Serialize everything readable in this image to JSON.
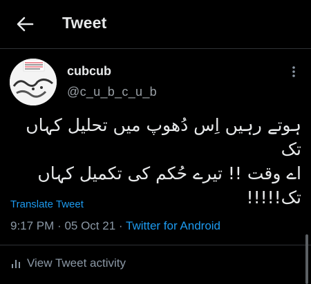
{
  "header": {
    "title": "Tweet",
    "back_icon": "arrow-left-icon"
  },
  "tweet": {
    "display_name": "cubcub",
    "handle": "@c_u_b_c_u_b",
    "more_icon": "vertical-ellipsis-icon",
    "text_lines": [
      "ہوتے رہیں اِس دُھوپ میں تحلیل کہاں تک",
      "اے وقت !! تیرے حُکم کی تکمیل کہاں",
      "تک!!!!!"
    ],
    "translate_label": "Translate Tweet",
    "time": "9:17 PM",
    "date": "05 Oct 21",
    "separator": "·",
    "source": "Twitter for Android",
    "activity_label": "View Tweet activity",
    "activity_icon": "bar-chart-icon"
  },
  "colors": {
    "background": "#000000",
    "text": "#e7e9ea",
    "muted": "#8b98a5",
    "link": "#1d9bf0",
    "border": "#2f3336"
  }
}
